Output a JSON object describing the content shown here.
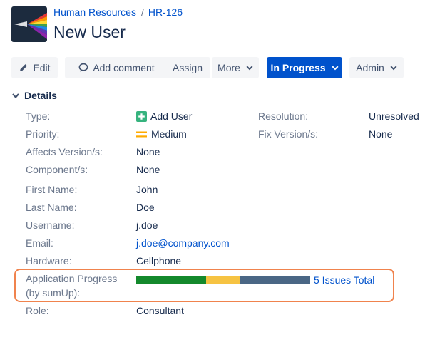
{
  "breadcrumb": {
    "project": "Human Resources",
    "separator": "/",
    "issue_key": "HR-126"
  },
  "issue": {
    "title": "New User"
  },
  "toolbar": {
    "edit": "Edit",
    "add_comment": "Add comment",
    "assign": "Assign",
    "more": "More",
    "status": "In Progress",
    "admin": "Admin"
  },
  "details": {
    "section_label": "Details",
    "type_label": "Type:",
    "type_value": "Add User",
    "priority_label": "Priority:",
    "priority_value": "Medium",
    "resolution_label": "Resolution:",
    "resolution_value": "Unresolved",
    "fixversion_label": "Fix Version/s:",
    "fixversion_value": "None",
    "affects_label": "Affects Version/s:",
    "affects_value": "None",
    "component_label": "Component/s:",
    "component_value": "None"
  },
  "fields": {
    "first_name_label": "First Name:",
    "first_name": "John",
    "last_name_label": "Last Name:",
    "last_name": "Doe",
    "username_label": "Username:",
    "username": "j.doe",
    "email_label": "Email:",
    "email": "j.doe@company.com",
    "hardware_label": "Hardware:",
    "hardware": "Cellphone",
    "progress_label_line1": "Application Progress",
    "progress_label_line2": "(by sumUp):",
    "progress_total": "5 Issues Total",
    "progress_segments": [
      {
        "status": "done",
        "fraction": 0.4,
        "color": "#14892c"
      },
      {
        "status": "in-progress",
        "fraction": 0.2,
        "color": "#f6c342"
      },
      {
        "status": "to-do",
        "fraction": 0.4,
        "color": "#4a6785"
      }
    ],
    "role_label": "Role:",
    "role": "Consultant"
  },
  "colors": {
    "accent": "#0052cc",
    "highlight": "#f0834d",
    "type_icon": "#36b37e",
    "priority_icon": "#ffab00"
  }
}
